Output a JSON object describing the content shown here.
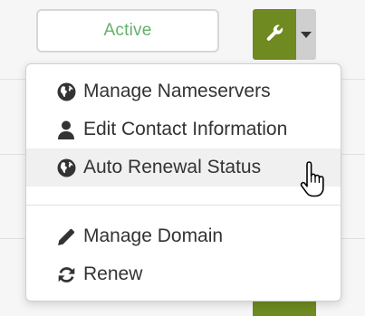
{
  "status": {
    "label": "Active"
  },
  "tools": {
    "button_icon": "wrench-icon",
    "toggle_icon": "caret-down-icon",
    "accent_color": "#6e8a20"
  },
  "menu": {
    "items": [
      {
        "label": "Manage Nameservers",
        "icon": "globe-icon"
      },
      {
        "label": "Edit Contact Information",
        "icon": "user-icon"
      },
      {
        "label": "Auto Renewal Status",
        "icon": "globe-icon",
        "hovered": true
      },
      {
        "label": "Manage Domain",
        "icon": "pencil-icon"
      },
      {
        "label": "Renew",
        "icon": "refresh-icon"
      }
    ]
  },
  "colors": {
    "status_text": "#66b06b",
    "menu_text": "#333333",
    "hover_bg": "#f0f0f0"
  }
}
